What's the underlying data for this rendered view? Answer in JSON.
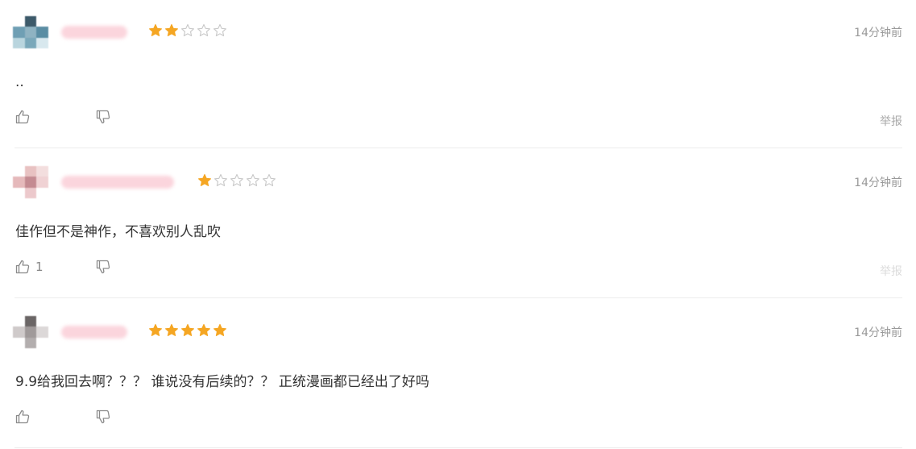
{
  "reviews": [
    {
      "username": "",
      "rating": 2,
      "max_rating": 5,
      "time": "14分钟前",
      "content": "..",
      "like_count": "",
      "report_label": "举报",
      "avatar_colors": [
        "#ffffff",
        "#3d5a6a",
        "#ffffff",
        "#6f9fb4",
        "#8fb3c2",
        "#5a8da3",
        "#b9d5de",
        "#7aa8ba",
        "#d8e8ee"
      ],
      "username_color": "#fbd5dd"
    },
    {
      "username": "",
      "rating": 1,
      "max_rating": 5,
      "time": "14分钟前",
      "content": "佳作但不是神作，不喜欢别人乱吹",
      "like_count": "1",
      "report_label": "举报",
      "avatar_colors": [
        "#ffffff",
        "#e8c2c2",
        "#f3dede",
        "#e5b9bb",
        "#c48b92",
        "#f0d2d4",
        "#ffffff",
        "#ecc9cc",
        "#ffffff"
      ],
      "username_color": "#fbd5dd"
    },
    {
      "username": "",
      "rating": 5,
      "max_rating": 5,
      "time": "14分钟前",
      "content": "9.9给我回去啊？？？ 谁说没有后续的？？ 正统漫画都已经出了好吗",
      "like_count": "",
      "report_label": "",
      "avatar_colors": [
        "#ffffff",
        "#6b6666",
        "#ffffff",
        "#cfcaca",
        "#a09a9a",
        "#dcd8d8",
        "#ffffff",
        "#b3aeae",
        "#ffffff"
      ],
      "username_color": "#fbd5dd"
    }
  ],
  "colors": {
    "star_filled": "#f5a623",
    "star_empty": "#c8c8c8",
    "icon": "#8a8a8a"
  },
  "icons": {
    "like": "thumbs-up-icon",
    "dislike": "thumbs-down-icon",
    "star": "star-icon"
  }
}
